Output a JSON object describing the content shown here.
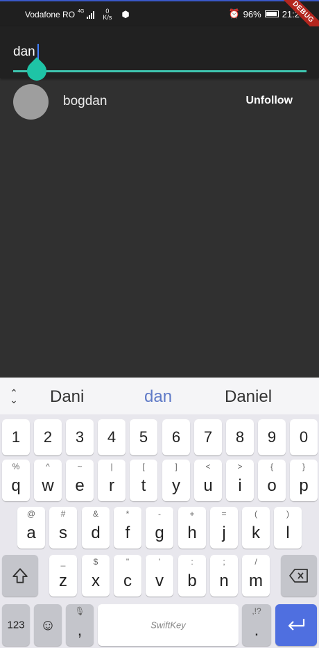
{
  "status_bar": {
    "carrier": "Vodafone RO",
    "network_type": "4G",
    "net_speed_value": "0",
    "net_speed_unit": "K/s",
    "battery_percent": "96%",
    "time": "21:2",
    "debug_banner": "DEBUG"
  },
  "search": {
    "value": "dan"
  },
  "results": [
    {
      "username": "bogdan",
      "action_label": "Unfollow"
    }
  ],
  "keyboard": {
    "suggestions": [
      "Dani",
      "dan",
      "Daniel"
    ],
    "number_row": [
      "1",
      "2",
      "3",
      "4",
      "5",
      "6",
      "7",
      "8",
      "9",
      "0"
    ],
    "row1": [
      {
        "main": "q",
        "alt": "%"
      },
      {
        "main": "w",
        "alt": "^"
      },
      {
        "main": "e",
        "alt": "~"
      },
      {
        "main": "r",
        "alt": "|"
      },
      {
        "main": "t",
        "alt": "["
      },
      {
        "main": "y",
        "alt": "]"
      },
      {
        "main": "u",
        "alt": "<"
      },
      {
        "main": "i",
        "alt": ">"
      },
      {
        "main": "o",
        "alt": "{"
      },
      {
        "main": "p",
        "alt": "}"
      }
    ],
    "row2": [
      {
        "main": "a",
        "alt": "@"
      },
      {
        "main": "s",
        "alt": "#"
      },
      {
        "main": "d",
        "alt": "&"
      },
      {
        "main": "f",
        "alt": "*"
      },
      {
        "main": "g",
        "alt": "-"
      },
      {
        "main": "h",
        "alt": "+"
      },
      {
        "main": "j",
        "alt": "="
      },
      {
        "main": "k",
        "alt": "("
      },
      {
        "main": "l",
        "alt": ")"
      }
    ],
    "row3": [
      {
        "main": "z",
        "alt": "_"
      },
      {
        "main": "x",
        "alt": "$"
      },
      {
        "main": "c",
        "alt": "\""
      },
      {
        "main": "v",
        "alt": "'"
      },
      {
        "main": "b",
        "alt": ":"
      },
      {
        "main": "n",
        "alt": ";"
      },
      {
        "main": "m",
        "alt": "/"
      }
    ],
    "symbols_label": "123",
    "comma_label": ",",
    "space_label": "SwiftKey",
    "period_alt": ",!?",
    "period_label": "."
  },
  "colors": {
    "accent": "#1ec4a6",
    "background": "#303030",
    "app_bar": "#212121",
    "enter_key": "#4f6fe0"
  }
}
